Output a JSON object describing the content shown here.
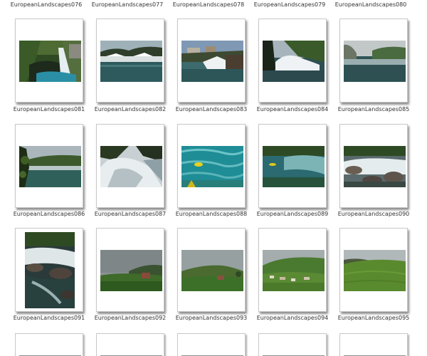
{
  "top_row_labels": [
    "EuropeanLandscapes076",
    "EuropeanLandscapes077",
    "EuropeanLandscapes078",
    "EuropeanLandscapes079",
    "EuropeanLandscapes080"
  ],
  "rows": [
    {
      "labels": [
        "EuropeanLandscapes081",
        "EuropeanLandscapes082",
        "EuropeanLandscapes083",
        "EuropeanLandscapes084",
        "EuropeanLandscapes085"
      ]
    },
    {
      "labels": [
        "EuropeanLandscapes086",
        "EuropeanLandscapes087",
        "EuropeanLandscapes088",
        "EuropeanLandscapes089",
        "EuropeanLandscapes090"
      ]
    },
    {
      "labels": [
        "EuropeanLandscapes091",
        "EuropeanLandscapes092",
        "EuropeanLandscapes093",
        "EuropeanLandscapes094",
        "EuropeanLandscapes095"
      ]
    }
  ],
  "thumbnail_subjects": [
    [
      "waterfall-grotto",
      "river-rapids",
      "waterfall-town",
      "waterfall-cliff",
      "misty-river"
    ],
    [
      "river-forest",
      "cascade-closeup",
      "rafting-turquoise",
      "raft-river",
      "rocky-falls"
    ],
    [
      "rocky-torrent",
      "cloudy-meadow",
      "hills-farm",
      "green-village",
      "green-hills"
    ]
  ]
}
